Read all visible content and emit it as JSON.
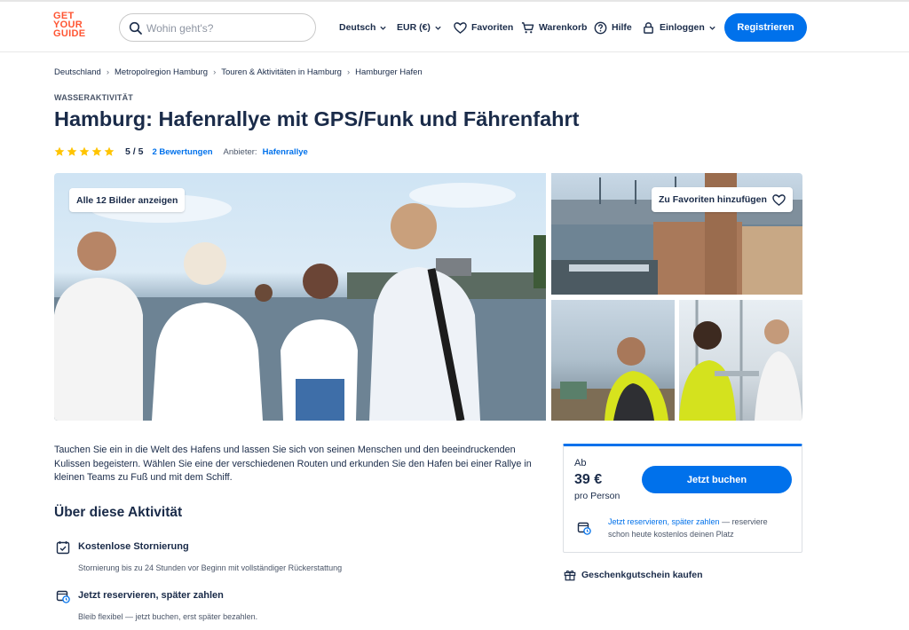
{
  "header": {
    "logo_lines": [
      "GET",
      "YOUR",
      "GUIDE"
    ],
    "search_placeholder": "Wohin geht's?",
    "language": "Deutsch",
    "currency": "EUR (€)",
    "favorites": "Favoriten",
    "cart": "Warenkorb",
    "help": "Hilfe",
    "login": "Einloggen",
    "register": "Registrieren"
  },
  "breadcrumb": [
    "Deutschland",
    "Metropolregion Hamburg",
    "Touren & Aktivitäten in Hamburg",
    "Hamburger Hafen"
  ],
  "activity": {
    "category": "WASSERAKTIVITÄT",
    "title": "Hamburg: Hafenrallye mit GPS/Funk und Fährenfahrt",
    "rating": 5,
    "rating_text": "5 / 5",
    "reviews": "2 Bewertungen",
    "provider_label": "Anbieter:",
    "provider": "Hafenrallye"
  },
  "gallery": {
    "show_all": "Alle 12 Bilder anzeigen",
    "add_favorite": "Zu Favoriten hinzufügen"
  },
  "description": "Tauchen Sie ein in die Welt des Hafens und lassen Sie sich von seinen Menschen und den beeindruckenden Kulissen begeistern. Wählen Sie eine der verschiedenen Routen und erkunden Sie den Hafen bei einer Rallye in kleinen Teams zu Fuß und mit dem Schiff.",
  "about": {
    "title": "Über diese Aktivität",
    "features": [
      {
        "title": "Kostenlose Stornierung",
        "desc": "Stornierung bis zu 24 Stunden vor Beginn mit vollständiger Rückerstattung"
      },
      {
        "title": "Jetzt reservieren, später zahlen",
        "desc": "Bleib flexibel — jetzt buchen, erst später bezahlen."
      }
    ]
  },
  "booking": {
    "from": "Ab",
    "price": "39 €",
    "per": "pro Person",
    "book_button": "Jetzt buchen",
    "reserve_link": "Jetzt reservieren, später zahlen",
    "reserve_rest": " — reserviere schon heute kostenlos deinen Platz"
  },
  "gift": "Geschenkgutschein kaufen",
  "colors": {
    "brand": "#ff5533",
    "accent": "#0071eb",
    "text": "#1a2b49",
    "star": "#ffc400"
  }
}
